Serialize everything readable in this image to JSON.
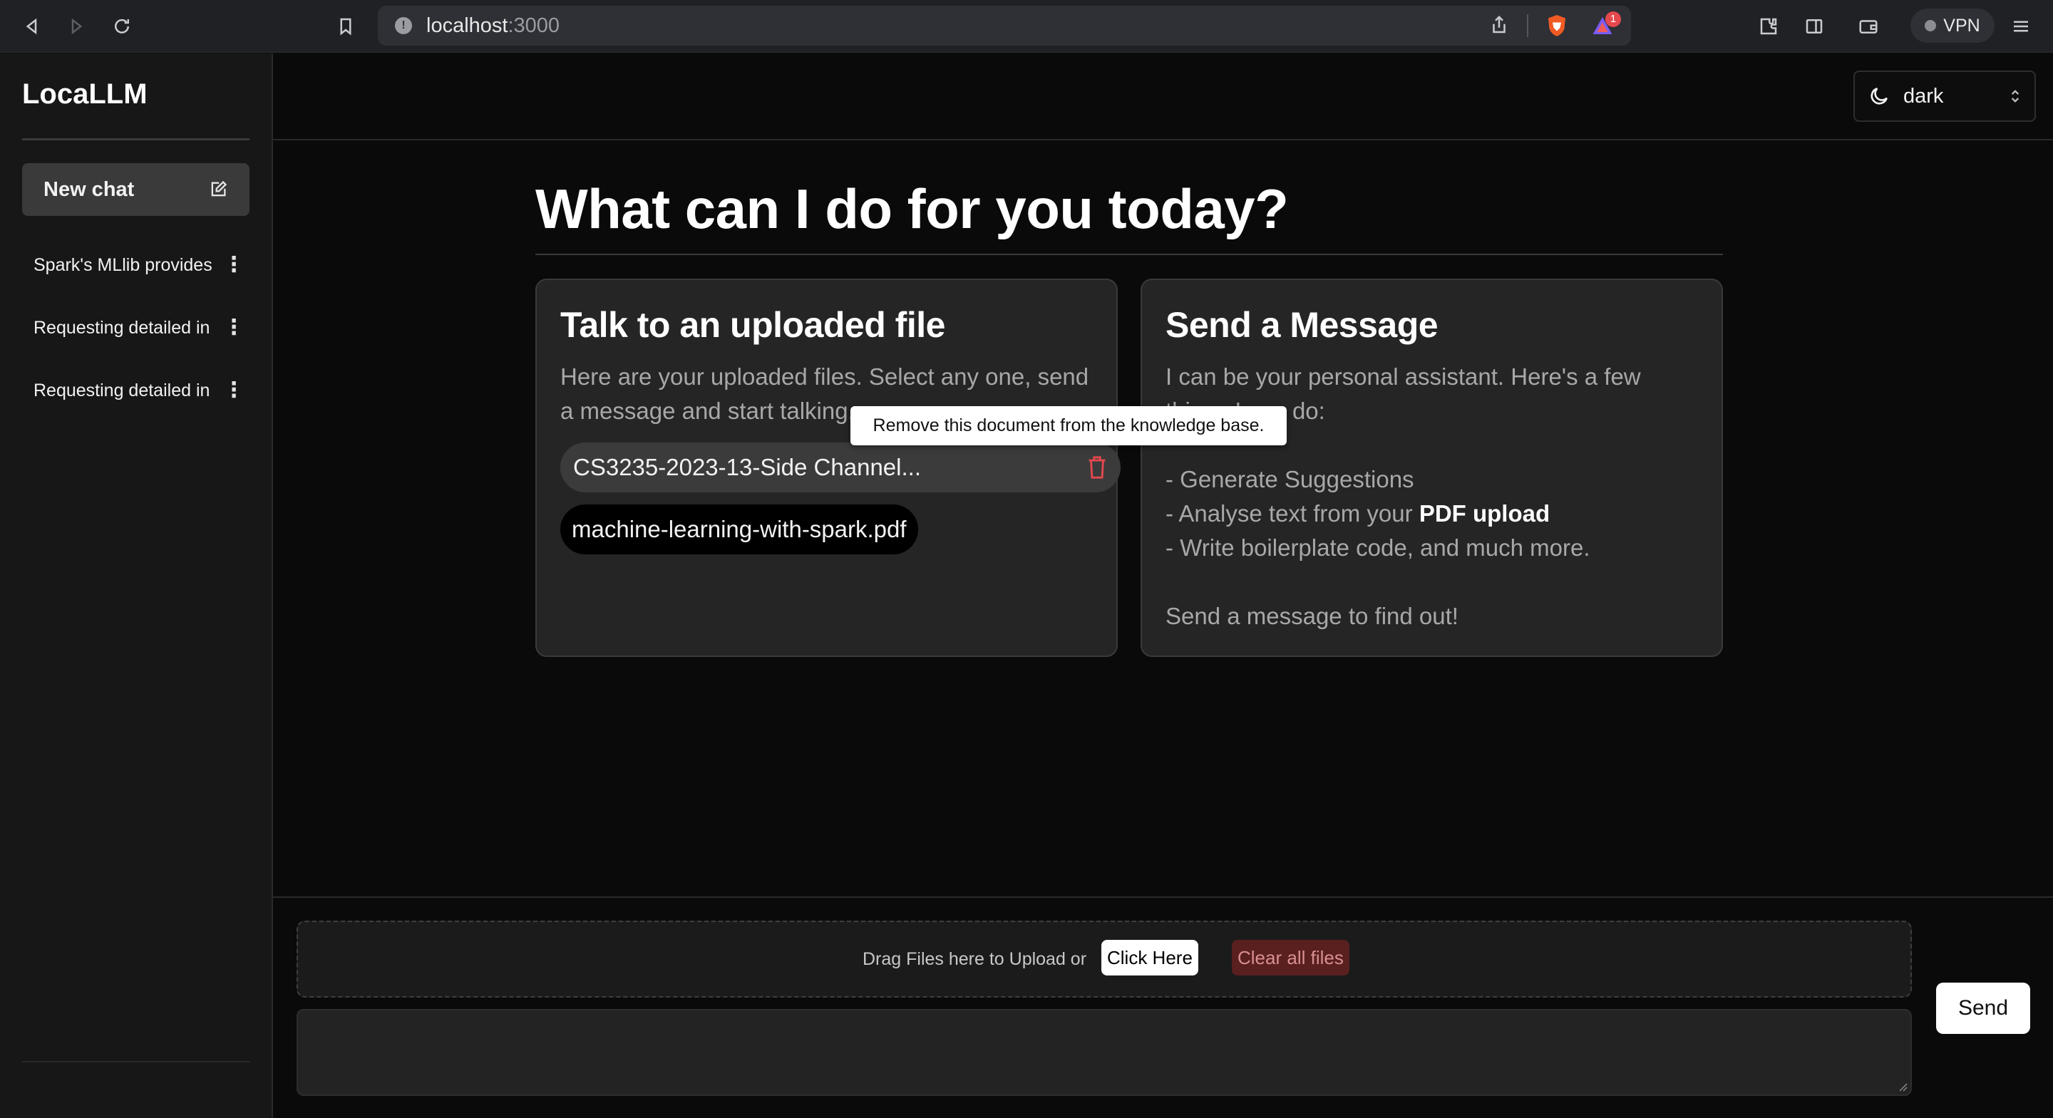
{
  "browser": {
    "url_host": "localhost",
    "url_port": ":3000",
    "shields_badge": "1",
    "vpn_label": "VPN"
  },
  "sidebar": {
    "brand": "LocaLLM",
    "new_chat_label": "New chat",
    "history": [
      {
        "label": "Spark's MLlib provides"
      },
      {
        "label": "Requesting detailed in"
      },
      {
        "label": "Requesting detailed in"
      }
    ]
  },
  "header": {
    "theme_value": "dark"
  },
  "main": {
    "heading": "What can I do for you today?",
    "files_card": {
      "title": "Talk to an uploaded file",
      "description": "Here are your uploaded files. Select any one, send a message and start talking.",
      "files": [
        {
          "name": "CS3235-2023-13-Side Channel...",
          "selected": true
        },
        {
          "name": "machine-learning-with-spark.pdf",
          "selected": false
        }
      ],
      "tooltip": "Remove this document from the knowledge base."
    },
    "message_card": {
      "title": "Send a Message",
      "intro_line1": "I can be your personal assistant. Here's a few",
      "intro_line2": "things I can do:",
      "items": [
        {
          "prefix": "- Generate Suggestions",
          "bold": ""
        },
        {
          "prefix": "- Analyse text from your ",
          "bold": "PDF upload"
        },
        {
          "prefix": "- Write boilerplate code, and much more.",
          "bold": ""
        }
      ],
      "outro": "Send a message to find out!"
    }
  },
  "composer": {
    "dropzone_text": "Drag Files here to Upload or",
    "click_here_label": "Click Here",
    "clear_all_label": "Clear all files",
    "message_value": "",
    "send_label": "Send"
  },
  "colors": {
    "background": "#0a0a0a",
    "sidebar": "#171717",
    "card": "#252525",
    "danger": "#e5484d",
    "clear_bg": "#5a1f1f"
  }
}
